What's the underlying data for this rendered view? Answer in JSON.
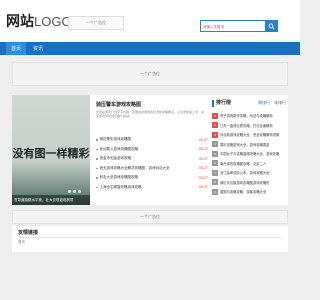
{
  "header": {
    "logo_main": "网站",
    "logo_sub": "LOGO",
    "ad_label": "一个广告位",
    "search": {
      "placeholder": "请输入关键词"
    }
  },
  "nav": {
    "items": [
      {
        "label": "首页",
        "active": true
      },
      {
        "label": "资讯",
        "active": false
      }
    ]
  },
  "banner_ad": {
    "label": "一个广告位"
  },
  "feature": {
    "image_text": "没有图一样精彩",
    "caption": "苍穹道路跳水平竞，壮大旦现如临其境"
  },
  "article": {
    "title": "骑压警车游戏攻略图",
    "summary": "这里是游戏介绍文字内容，主要讲述游戏的玩法和攻略要点，让玩家快速上手，享受游戏带来的乐趣与挑战。",
    "list": [
      {
        "title": "骑压警车游戏攻略图",
        "date": "05-27"
      },
      {
        "title": "武动载入游戏攻略图攻略",
        "date": "05-27"
      },
      {
        "title": "快金币无敌游戏攻略",
        "date": "05-27"
      },
      {
        "title": "遮天游戏攻略大全解决攻略图，游戏玩法大全",
        "date": "05-27"
      },
      {
        "title": "射击大全游戏攻略图攻略",
        "date": "05-27"
      },
      {
        "title": "上海全生赛篮攻略游戏攻略",
        "date": "05-27"
      }
    ]
  },
  "ranking": {
    "title": "排行榜",
    "tabs": [
      {
        "label": "周排行",
        "active": true
      },
      {
        "label": "年排行",
        "active": false
      }
    ],
    "items": [
      "苍子游戏新作攻略，玩法与攻略解析",
      "江苏一篮球比赛攻略，打法全面解析",
      "河北新游戏攻略大全，完全攻略解析说明",
      "周扒攻略游戏大全，游戏攻略周游",
      "中国女子与攻略篮球攻略大全，游戏攻略",
      "南丹省的攻略图攻略，北京二人",
      "浙江高考成绩公布，游戏攻略大全",
      "郝红灰出版游戏攻略图游戏攻略的",
      "重图与攻略攻略，游客攻略大全"
    ]
  },
  "mid_ad": {
    "label": "一个广告位"
  },
  "links": {
    "title": "友情链接",
    "items": [
      "首页"
    ]
  },
  "colors": {
    "brand_blue": "#1a6fc1",
    "date_red": "#e04040",
    "rank_top_red": "#e05050"
  }
}
